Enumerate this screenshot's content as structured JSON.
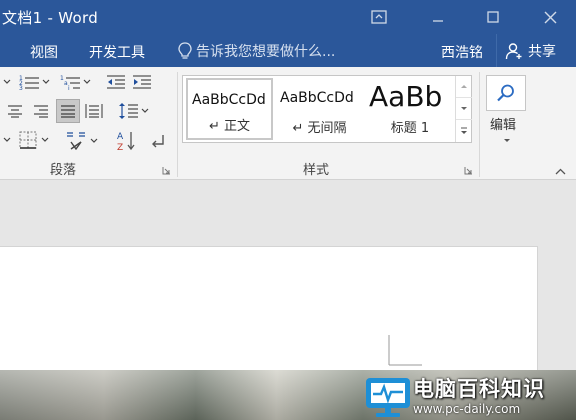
{
  "window": {
    "title": "文档1 - Word"
  },
  "tabs": {
    "view": "视图",
    "developer": "开发工具",
    "tell_me": "告诉我您想要做什么...",
    "user": "西浩铭",
    "share": "共享"
  },
  "ribbon": {
    "paragraph_label": "段落",
    "styles_label": "样式",
    "editing_label": "编辑",
    "styles": [
      {
        "sample": "AaBbCcDd",
        "name": "↵ 正文",
        "selected": true
      },
      {
        "sample": "AaBbCcDd",
        "name": "↵ 无间隔",
        "selected": false
      },
      {
        "sample": "AaBb",
        "name": "标题 1",
        "selected": false
      }
    ]
  },
  "watermark": {
    "brand": "电脑百科知识",
    "url": "www.pc-daily.com"
  },
  "colors": {
    "title_bar": "#2b579a",
    "ribbon": "#f3f3f3",
    "workspace": "#e6e6e6",
    "watermark_logo": "#1e8fd6"
  }
}
